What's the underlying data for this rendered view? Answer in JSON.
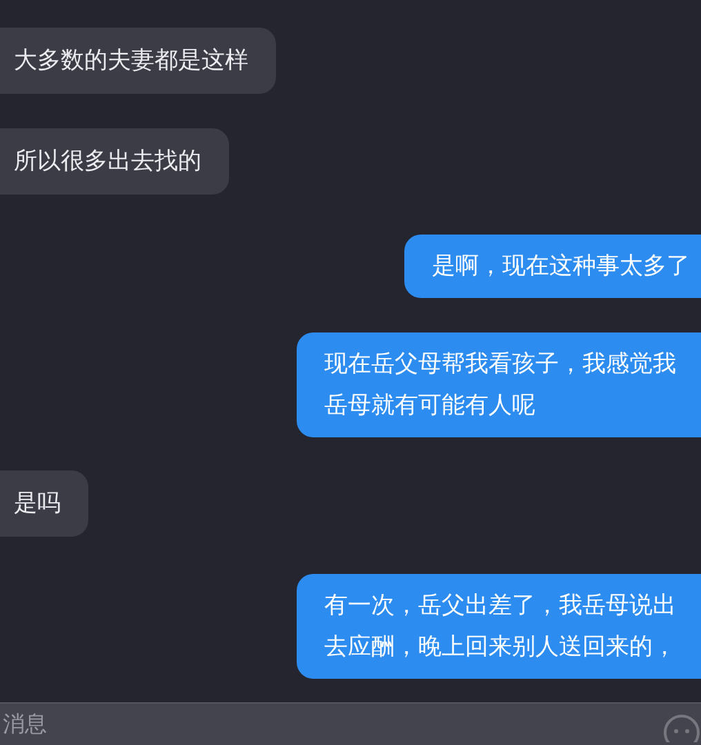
{
  "messages": [
    {
      "kind": "received",
      "text": "大多数的夫妻都是这样"
    },
    {
      "kind": "received",
      "text": "所以很多出去找的"
    },
    {
      "kind": "sent",
      "text": "是啊，现在这种事太多了"
    },
    {
      "kind": "sent",
      "text": "现在岳父母帮我看孩子，我感觉我岳母就有可能有人呢"
    },
    {
      "kind": "received",
      "text": "是吗"
    },
    {
      "kind": "sent",
      "text": "有一次，岳父出差了，我岳母说出去应酬，晚上回来别人送回来的，"
    }
  ],
  "composer": {
    "placeholder": "消息"
  }
}
